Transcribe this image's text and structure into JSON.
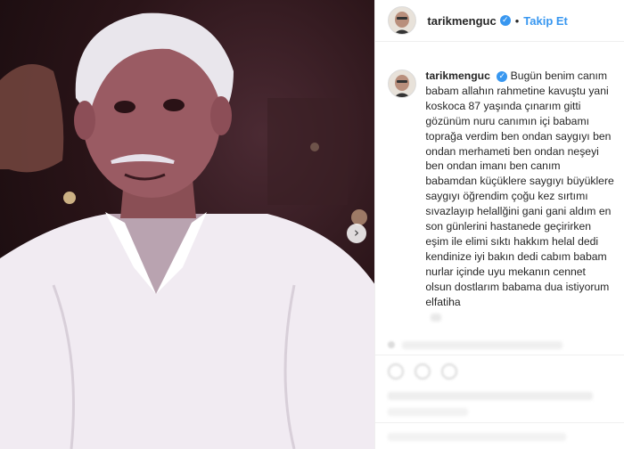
{
  "post": {
    "username": "tarikmenguc",
    "follow_label": "Takip Et",
    "verified_icon": "verified-badge-icon",
    "separator": "•",
    "next_icon": "chevron-right-icon",
    "next_glyph": "›"
  },
  "caption": {
    "username": "tarikmenguc",
    "text": "Bugün benim canım babam allahın rahmetine kavuştu yani koskoca 87 yaşında çınarım gitti gözünüm nuru canımın içi babamı toprağa verdim ben ondan saygıyı ben ondan merhameti ben ondan neşeyi ben ondan imanı ben canım babamdan küçüklere saygıyı büyüklere saygıyı öğrendim çoğu kez sırtımı sıvazlayıp helallğini gani gani aldım en son günlerini hastanede geçirirken eşim ile elimi sıktı hakkım helal dedi kendinize iyi bakın dedi cabım babam nurlar içinde uyu mekanın cennet olsun dostlarım babama dua istiyorum elfatiha"
  },
  "colors": {
    "accent": "#3897f0",
    "text": "#262626",
    "border": "#efefef"
  }
}
